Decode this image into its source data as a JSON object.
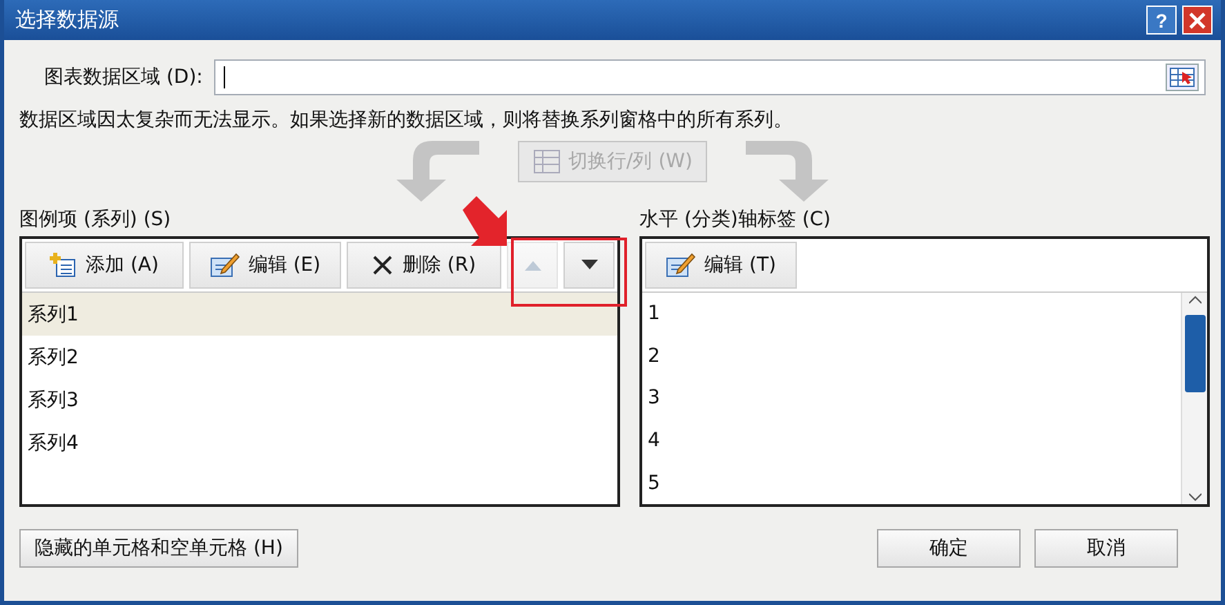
{
  "window": {
    "title": "选择数据源",
    "help": "?"
  },
  "range": {
    "label": "图表数据区域 (D):"
  },
  "message": "数据区域因太复杂而无法显示。如果选择新的数据区域，则将替换系列窗格中的所有系列。",
  "switch_button": {
    "label": "切换行/列 (W)",
    "disabled": true
  },
  "legend": {
    "label": "图例项 (系列) (S)",
    "buttons": [
      {
        "kind": "add",
        "label": "添加 (A)",
        "disabled": false
      },
      {
        "kind": "edit",
        "label": "编辑 (E)",
        "disabled": false
      },
      {
        "kind": "delete",
        "label": "删除 (R)",
        "disabled": false
      },
      {
        "kind": "up",
        "disabled": true
      },
      {
        "kind": "down",
        "disabled": false
      }
    ],
    "items": [
      {
        "label": "系列1",
        "selected": true
      },
      {
        "label": "系列2",
        "selected": false
      },
      {
        "label": "系列3",
        "selected": false
      },
      {
        "label": "系列4",
        "selected": false
      }
    ]
  },
  "axis": {
    "label": "水平 (分类)轴标签 (C)",
    "buttons": [
      {
        "kind": "edit",
        "label": "编辑 (T)",
        "disabled": false
      }
    ],
    "items": [
      {
        "label": "1",
        "selected": false
      },
      {
        "label": "2",
        "selected": false
      },
      {
        "label": "3",
        "selected": false
      },
      {
        "label": "4",
        "selected": false
      },
      {
        "label": "5",
        "selected": false
      }
    ]
  },
  "footer": {
    "hidden_cells_button": "隐藏的单元格和空单元格 (H)",
    "ok": "确定",
    "cancel": "取消"
  }
}
